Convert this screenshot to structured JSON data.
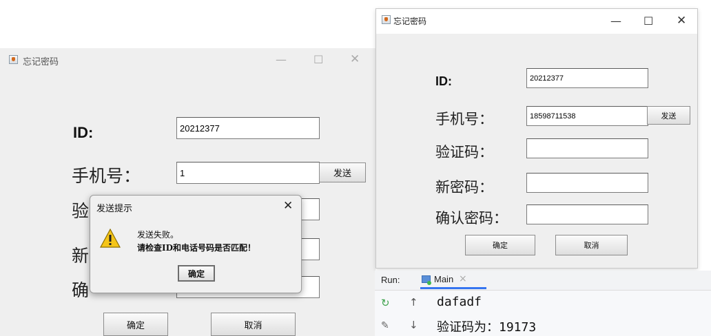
{
  "left_window": {
    "title": "忘记密码",
    "id_label": "ID:",
    "id_value": "20212377",
    "phone_label": "手机号：",
    "phone_value": "1",
    "send_button": "发送",
    "confirm_button": "确定",
    "cancel_button": "取消",
    "label_verify_partial": "验",
    "label_new_partial": "新",
    "label_confirm_partial": "确"
  },
  "dialog": {
    "title": "发送提示",
    "close_glyph": "✕",
    "message_line1": "发送失败。",
    "message_line2": "请检查ID和电话号码是否匹配！",
    "ok_button": "确定"
  },
  "right_window": {
    "title": "忘记密码",
    "id_label": "ID:",
    "id_value": "20212377",
    "phone_label": "手机号：",
    "phone_value": "18598711538",
    "send_button": "发送",
    "verify_label": "验证码：",
    "new_password_label": "新密码：",
    "confirm_password_label": "确认密码：",
    "confirm_button": "确定",
    "cancel_button": "取消"
  },
  "window_controls": {
    "minimize": "—",
    "maximize": "☐",
    "close": "✕"
  },
  "run_panel": {
    "run_label": "Run:",
    "tab_label": "Main",
    "tab_close": "×",
    "console_lines": [
      "dafadf",
      "验证码为：19173"
    ]
  },
  "colors": {
    "window_bg": "#efefef",
    "warning_yellow": "#f5c518",
    "run_tab_underline": "#3574f0"
  }
}
